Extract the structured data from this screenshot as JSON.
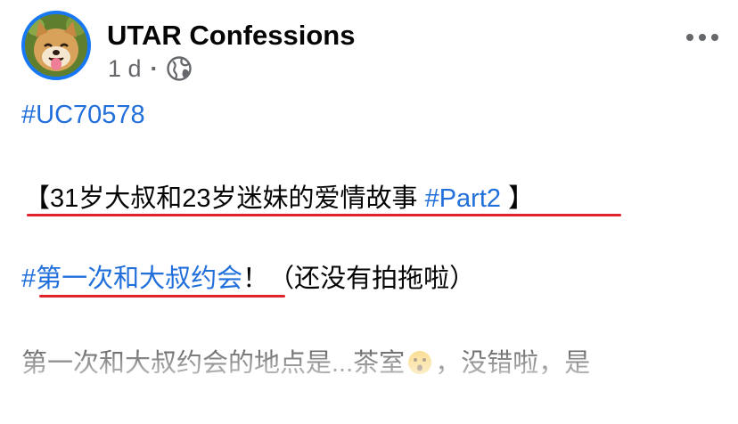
{
  "post": {
    "page_name": "UTAR Confessions",
    "time": "1 d",
    "separator": "·",
    "audience_icon": "globe-icon",
    "more_icon": "more-horizontal-icon",
    "avatar": "shiba-dog-avatar"
  },
  "content": {
    "hashtag_id": "#UC70578",
    "title_open": "【31岁大叔和23岁迷妹的爱情故事 ",
    "title_tag": "#Part2",
    "title_close": " 】",
    "date_tag": "#第一次和大叔约会",
    "date_rest": "！（还没有拍拖啦）",
    "body_before_emoji": "第一次和大叔约会的地点是...茶室",
    "body_emoji": "hushed-face-emoji",
    "body_after_emoji": "，没错啦，是"
  },
  "colors": {
    "link": "#216fdb",
    "underline": "#e0222d",
    "avatar_ring": "#1877f2",
    "meta_text": "#65676b"
  }
}
